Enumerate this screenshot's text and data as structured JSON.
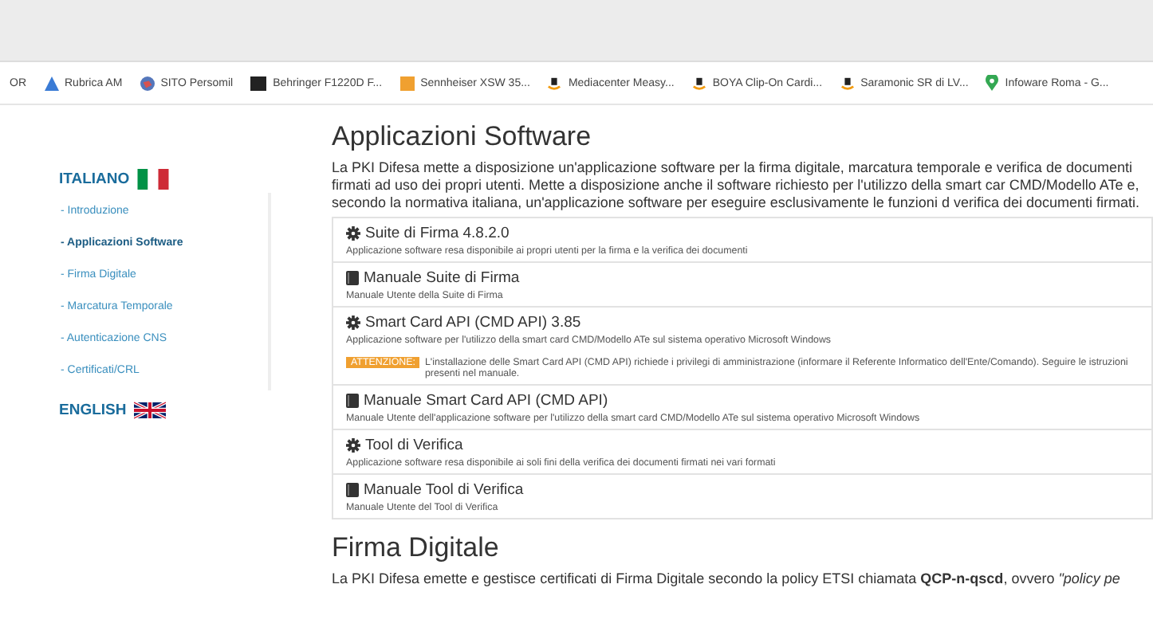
{
  "bookmarks": [
    {
      "label": "OR",
      "kind": "plain"
    },
    {
      "label": "Rubrica AM",
      "kind": "triangle"
    },
    {
      "label": "SITO Persomil",
      "kind": "globe"
    },
    {
      "label": "Behringer F1220D F...",
      "kind": "square"
    },
    {
      "label": "Sennheiser XSW 35...",
      "kind": "orange"
    },
    {
      "label": "Mediacenter Measy...",
      "kind": "shop"
    },
    {
      "label": "BOYA Clip-On Cardi...",
      "kind": "shop"
    },
    {
      "label": "Saramonic SR di LV...",
      "kind": "shop"
    },
    {
      "label": "Infoware Roma - G...",
      "kind": "pin"
    }
  ],
  "sidebar": {
    "italian": {
      "label": "ITALIANO",
      "items": [
        {
          "label": "- Introduzione",
          "selected": false
        },
        {
          "label": "- Applicazioni Software",
          "selected": true
        },
        {
          "label": "- Firma Digitale",
          "selected": false
        },
        {
          "label": "- Marcatura Temporale",
          "selected": false
        },
        {
          "label": "- Autenticazione CNS",
          "selected": false
        },
        {
          "label": "- Certificati/CRL",
          "selected": false
        }
      ]
    },
    "english": {
      "label": "ENGLISH"
    }
  },
  "main": {
    "title": "Applicazioni Software",
    "intro": "La PKI Difesa mette a disposizione un'applicazione software per la firma digitale, marcatura temporale e verifica de documenti firmati ad uso dei propri utenti. Mette a disposizione anche il software richiesto per l'utilizzo della smart car CMD/Modello ATe e, secondo la normativa italiana, un'applicazione software per eseguire esclusivamente le funzioni d verifica dei documenti firmati.",
    "downloads": [
      {
        "kind": "app",
        "title": "Suite di Firma 4.8.2.0",
        "description": "Applicazione software resa disponibile ai propri utenti per la firma e la verifica dei documenti"
      },
      {
        "kind": "manual",
        "title": "Manuale Suite di Firma",
        "description": "Manuale Utente della Suite di Firma"
      },
      {
        "kind": "app",
        "title": "Smart Card API (CMD API) 3.85",
        "description": "Applicazione software per l'utilizzo della smart card CMD/Modello ATe sul sistema operativo Microsoft Windows",
        "warning_badge": "ATTENZIONE:",
        "warning": "L'installazione delle Smart Card API (CMD API) richiede i privilegi di amministrazione (informare il Referente Informatico dell'Ente/Comando). Seguire le istruzioni presenti nel manuale."
      },
      {
        "kind": "manual",
        "title": "Manuale Smart Card API (CMD API)",
        "description": "Manuale Utente dell'applicazione software per l'utilizzo della smart card CMD/Modello ATe sul sistema operativo Microsoft Windows"
      },
      {
        "kind": "app",
        "title": "Tool di Verifica",
        "description": "Applicazione software resa disponibile ai soli fini della verifica dei documenti firmati nei vari formati"
      },
      {
        "kind": "manual",
        "title": "Manuale Tool di Verifica",
        "description": "Manuale Utente del Tool di Verifica"
      }
    ],
    "section2_title": "Firma Digitale",
    "section2_text": "La PKI Difesa emette e gestisce certificati di Firma Digitale secondo la policy ETSI chiamata **QCP-n-qscd**, ovvero *\"policy pe*"
  }
}
